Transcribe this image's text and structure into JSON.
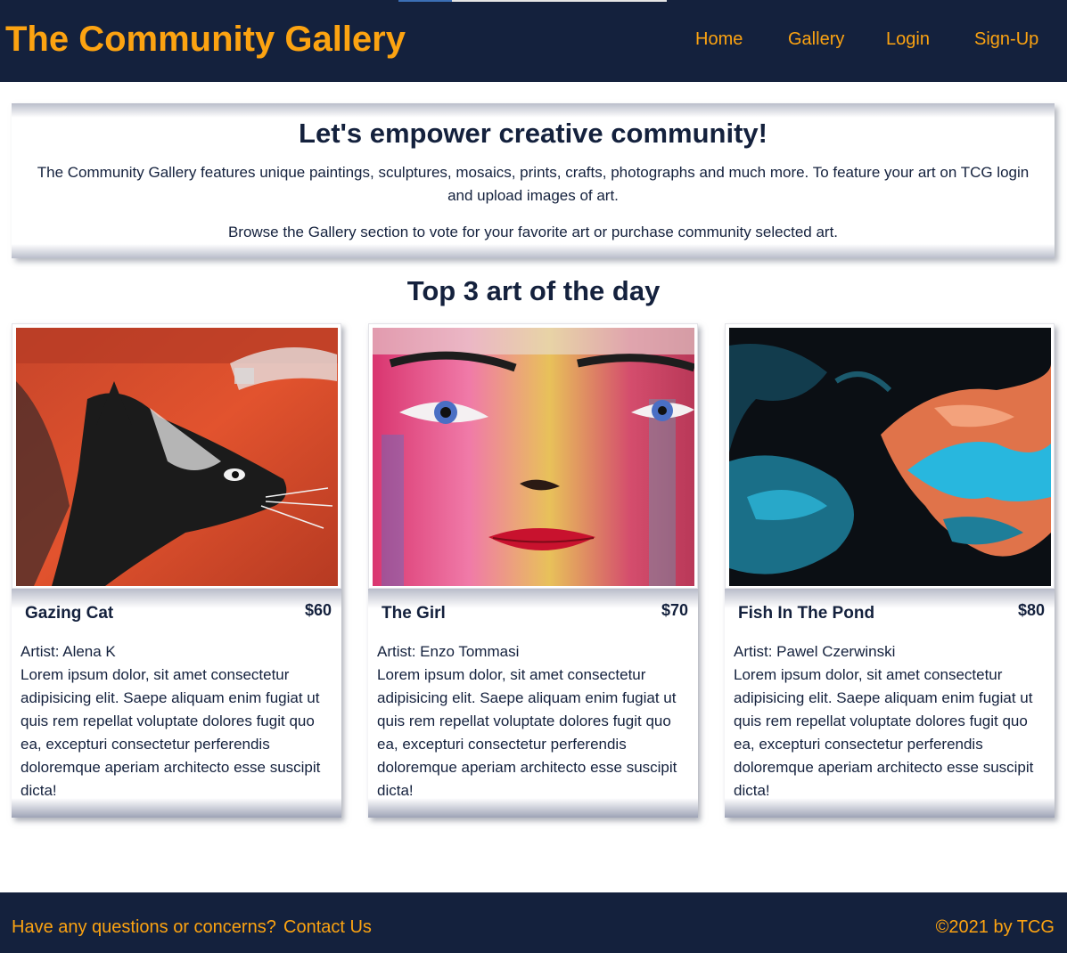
{
  "header": {
    "brand": "The Community Gallery",
    "nav": [
      {
        "label": "Home"
      },
      {
        "label": "Gallery"
      },
      {
        "label": "Login"
      },
      {
        "label": "Sign-Up"
      }
    ]
  },
  "intro": {
    "heading": "Let's empower creative community!",
    "paragraph1": "The Community Gallery features unique paintings, sculptures, mosaics, prints, crafts, photographs and much more. To feature your art on TCG login and upload images of art.",
    "paragraph2": "Browse the Gallery section to vote for your favorite art or purchase community selected art."
  },
  "top_art": {
    "heading": "Top 3 art of the day",
    "items": [
      {
        "title": "Gazing Cat",
        "price": "$60",
        "artist": "Artist: Alena K",
        "description": "Lorem ipsum dolor, sit amet consectetur adipisicing elit. Saepe aliquam enim fugiat ut quis rem repellat voluptate dolores fugit quo ea, excepturi consectetur perferendis doloremque aperiam architecto esse suscipit dicta!"
      },
      {
        "title": "The Girl",
        "price": "$70",
        "artist": "Artist: Enzo Tommasi",
        "description": "Lorem ipsum dolor, sit amet consectetur adipisicing elit. Saepe aliquam enim fugiat ut quis rem repellat voluptate dolores fugit quo ea, excepturi consectetur perferendis doloremque aperiam architecto esse suscipit dicta!"
      },
      {
        "title": "Fish In The Pond",
        "price": "$80",
        "artist": "Artist: Pawel Czerwinski",
        "description": "Lorem ipsum dolor, sit amet consectetur adipisicing elit. Saepe aliquam enim fugiat ut quis rem repellat voluptate dolores fugit quo ea, excepturi consectetur perferendis doloremque aperiam architecto esse suscipit dicta!"
      }
    ]
  },
  "footer": {
    "question": "Have any questions or concerns?",
    "contact_label": "Contact Us",
    "copyright": "©2021 by TCG"
  },
  "colors": {
    "navy": "#14213d",
    "accent": "#fca311"
  }
}
